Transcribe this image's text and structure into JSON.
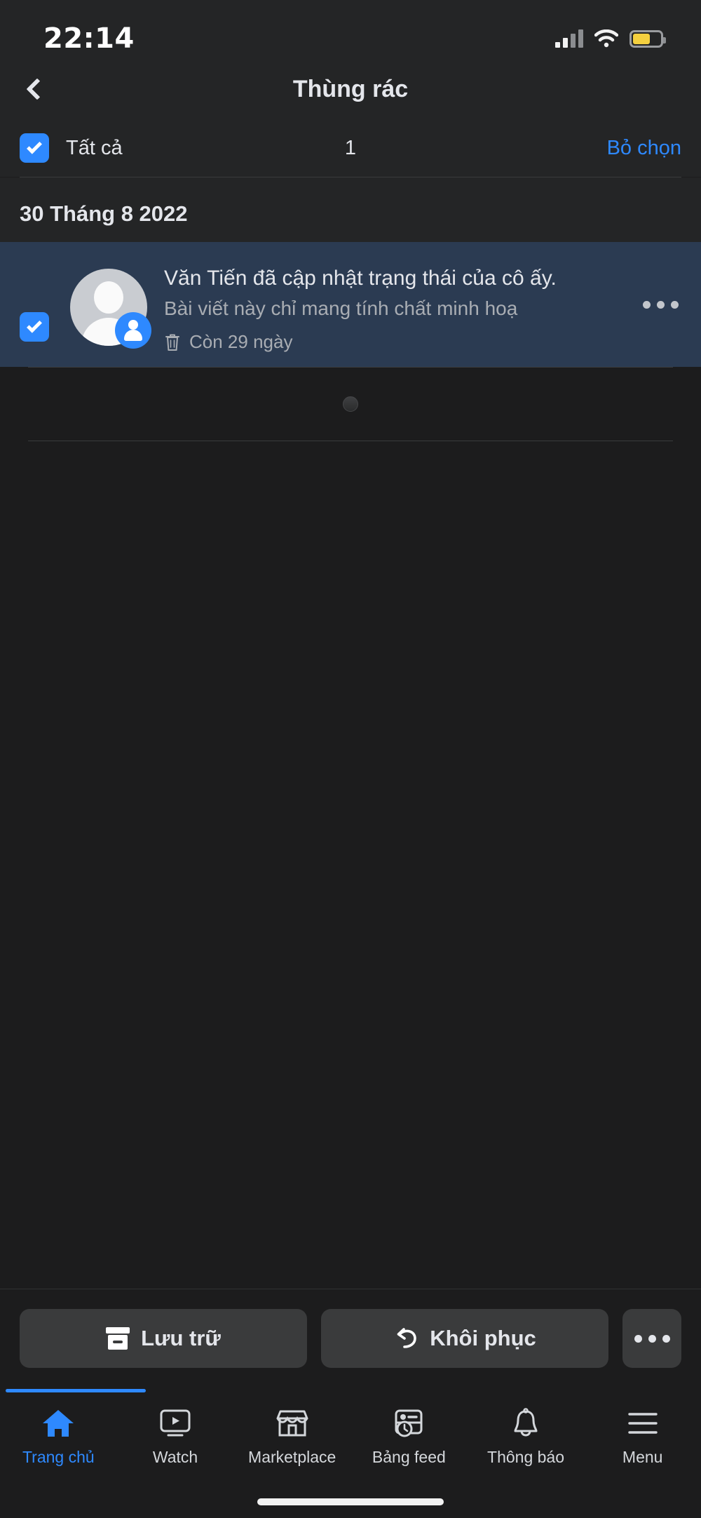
{
  "status_bar": {
    "time": "22:14",
    "icons": [
      "cellular-signal-icon",
      "wifi-icon",
      "battery-icon"
    ],
    "battery_color": "#f4d03f",
    "signal_bars_lit": 2,
    "signal_bars_total": 4
  },
  "nav": {
    "back_icon": "chevron-left-icon",
    "title": "Thùng rác"
  },
  "select_bar": {
    "checkbox_checked": true,
    "select_all_label": "Tất cả",
    "count": "1",
    "deselect_label": "Bỏ chọn",
    "accent": "#2e89ff"
  },
  "list": {
    "date_header": "30 Tháng 8 2022",
    "items": [
      {
        "selected": true,
        "avatar": "default-avatar-icon",
        "badge": "profile-badge-icon",
        "title": "Văn Tiến đã cập nhật trạng thái của cô ấy.",
        "subtitle": "Bài viết này chỉ mang tính chất minh hoạ",
        "meta_icon": "trash-icon",
        "meta_text": "Còn 29 ngày",
        "menu_icon": "more-horizontal-icon",
        "highlight_color": "#2b3b52"
      }
    ],
    "loading_spinner": "loading-spinner-icon"
  },
  "action_bar": {
    "archive": {
      "label": "Lưu trữ",
      "icon": "archive-icon"
    },
    "restore": {
      "label": "Khôi phục",
      "icon": "undo-icon"
    },
    "more": {
      "icon": "more-horizontal-icon"
    }
  },
  "tab_bar": {
    "active_index": 0,
    "tabs": [
      {
        "label": "Trang chủ",
        "icon": "home-icon"
      },
      {
        "label": "Watch",
        "icon": "watch-play-icon"
      },
      {
        "label": "Marketplace",
        "icon": "marketplace-store-icon"
      },
      {
        "label": "Bảng feed",
        "icon": "news-feed-icon"
      },
      {
        "label": "Thông báo",
        "icon": "bell-icon"
      },
      {
        "label": "Menu",
        "icon": "hamburger-menu-icon"
      }
    ]
  }
}
